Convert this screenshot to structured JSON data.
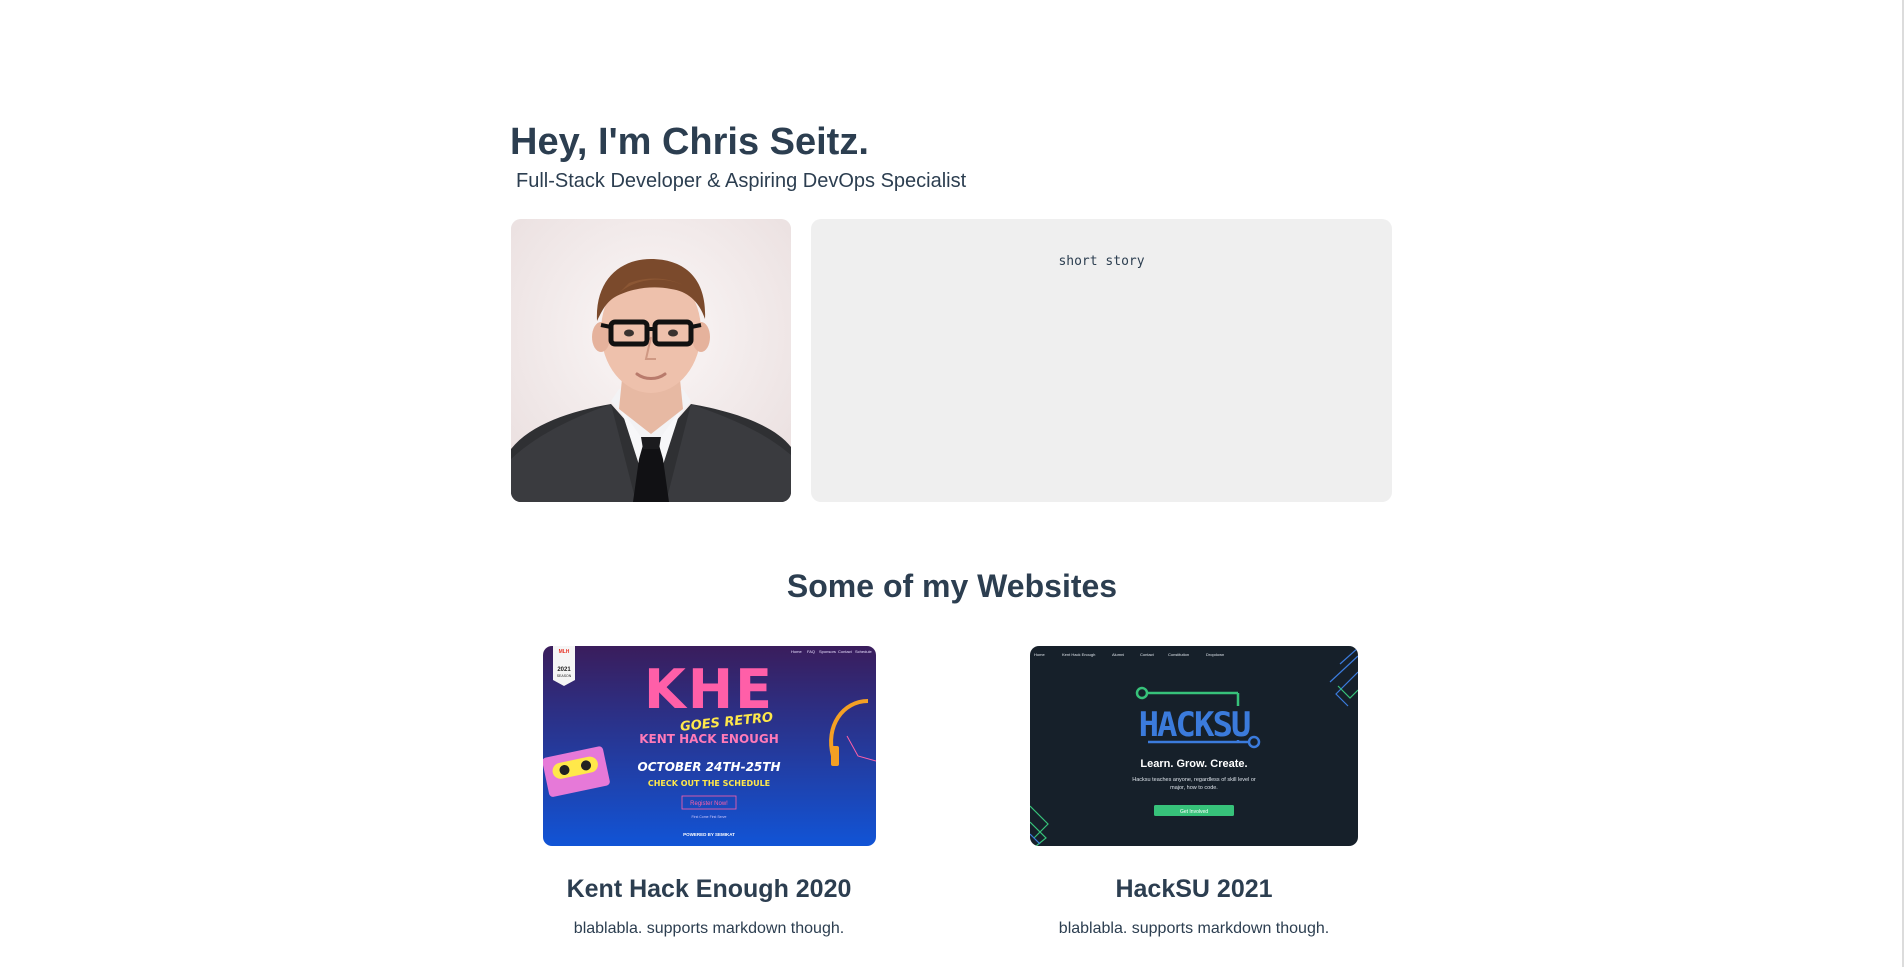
{
  "intro": {
    "heading": "Hey, I'm Chris Seitz.",
    "subtitle": "Full-Stack Developer & Aspiring DevOps Specialist"
  },
  "profile": {
    "image_label": "profile-photo"
  },
  "story": {
    "text": "short story"
  },
  "websites": {
    "section_title": "Some of my Websites",
    "items": [
      {
        "title": "Kent Hack Enough 2020",
        "description": "blablabla. supports markdown though.",
        "thumbnail": {
          "nav": [
            "Home",
            "FAQ",
            "Sponsors",
            "Contact",
            "Schedule"
          ],
          "badge_top": "MLH",
          "badge_year": "2021",
          "badge_bottom": "SEASON",
          "logo_text": "KHE",
          "tagline": "GOES RETRO",
          "event_name": "KENT HACK ENOUGH",
          "date": "OCTOBER 24TH-25TH",
          "cta": "CHECK OUT THE SCHEDULE",
          "register": "Register Now!",
          "note": "First Come First Serve",
          "powered": "POWERED BY SEMIKAT",
          "colors": {
            "bg_top": "#3a1d5c",
            "bg_bottom": "#1154d6",
            "pink": "#ff5fa8",
            "yellow": "#ffe84a"
          }
        }
      },
      {
        "title": "HackSU 2021",
        "description": "blablabla. supports markdown though.",
        "thumbnail": {
          "nav": [
            "Home",
            "Kent Hack Enough",
            "Alumni",
            "Contact",
            "Constitution",
            "Dropdown"
          ],
          "logo_text": "HACKSU",
          "tagline": "Learn. Grow. Create.",
          "blurb_line1": "Hacksu teaches anyone, regardless of skill level or",
          "blurb_line2": "major, how to code.",
          "button": "Get Involved",
          "colors": {
            "bg": "#16202a",
            "blue": "#3b7bdc",
            "green": "#37c27a"
          }
        }
      }
    ]
  }
}
